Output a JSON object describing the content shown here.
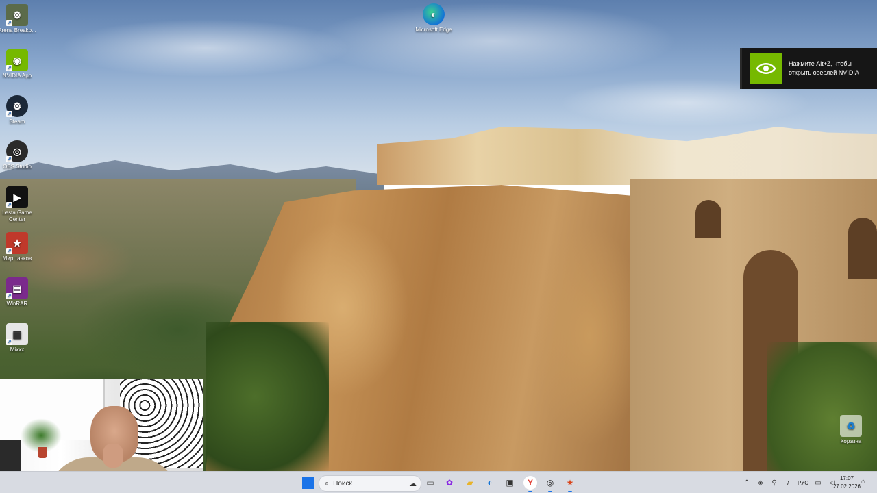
{
  "desktop": {
    "icons_left": [
      {
        "label": "Arena Breako...",
        "icon": "arena-breakout-icon",
        "color": "#5b6b4a",
        "glyph": "⚙"
      },
      {
        "label": "NVIDIA App",
        "icon": "nvidia-app-icon",
        "color": "#76b900",
        "glyph": "◉"
      },
      {
        "label": "Steam",
        "icon": "steam-icon",
        "color": "#1b2838",
        "glyph": "⚙"
      },
      {
        "label": "OBS Studio",
        "icon": "obs-studio-icon",
        "color": "#2b2b2b",
        "glyph": "◎"
      },
      {
        "label": "Lesta Game Center",
        "icon": "lesta-game-center-icon",
        "color": "#111111",
        "glyph": "▶"
      },
      {
        "label": "Мир танков",
        "icon": "mir-tankov-icon",
        "color": "#c0392b",
        "glyph": "★"
      },
      {
        "label": "WinRAR",
        "icon": "winrar-icon",
        "color": "#7b2a8c",
        "glyph": "▤"
      },
      {
        "label": "Mixxx",
        "icon": "mixxx-icon",
        "color": "#e6e6e6",
        "glyph": "▦"
      }
    ],
    "edge_icon": {
      "label": "Microsoft Edge",
      "icon": "microsoft-edge-icon"
    },
    "recycle_bin": {
      "label": "Корзина",
      "icon": "recycle-bin-icon"
    }
  },
  "nvidia_toast": {
    "text": "Нажмите Alt+Z, чтобы открыть оверлей NVIDIA",
    "accent": "#76b900"
  },
  "taskbar": {
    "search_placeholder": "Поиск",
    "pinned": [
      {
        "name": "file-explorer-icon",
        "glyph": "▭"
      },
      {
        "name": "colorful-app-icon",
        "glyph": "✿"
      },
      {
        "name": "folder-icon",
        "glyph": "▰"
      },
      {
        "name": "edge-taskbar-icon",
        "glyph": "◐"
      },
      {
        "name": "store-icon",
        "glyph": "▣"
      },
      {
        "name": "yandex-browser-icon",
        "glyph": "Y"
      },
      {
        "name": "obs-taskbar-icon",
        "glyph": "◎"
      },
      {
        "name": "game-center-taskbar-icon",
        "glyph": "★"
      }
    ],
    "tray": {
      "language": "РУС",
      "time": "17:07",
      "date": "27.02.2026"
    },
    "accent": "#1a73e8"
  }
}
